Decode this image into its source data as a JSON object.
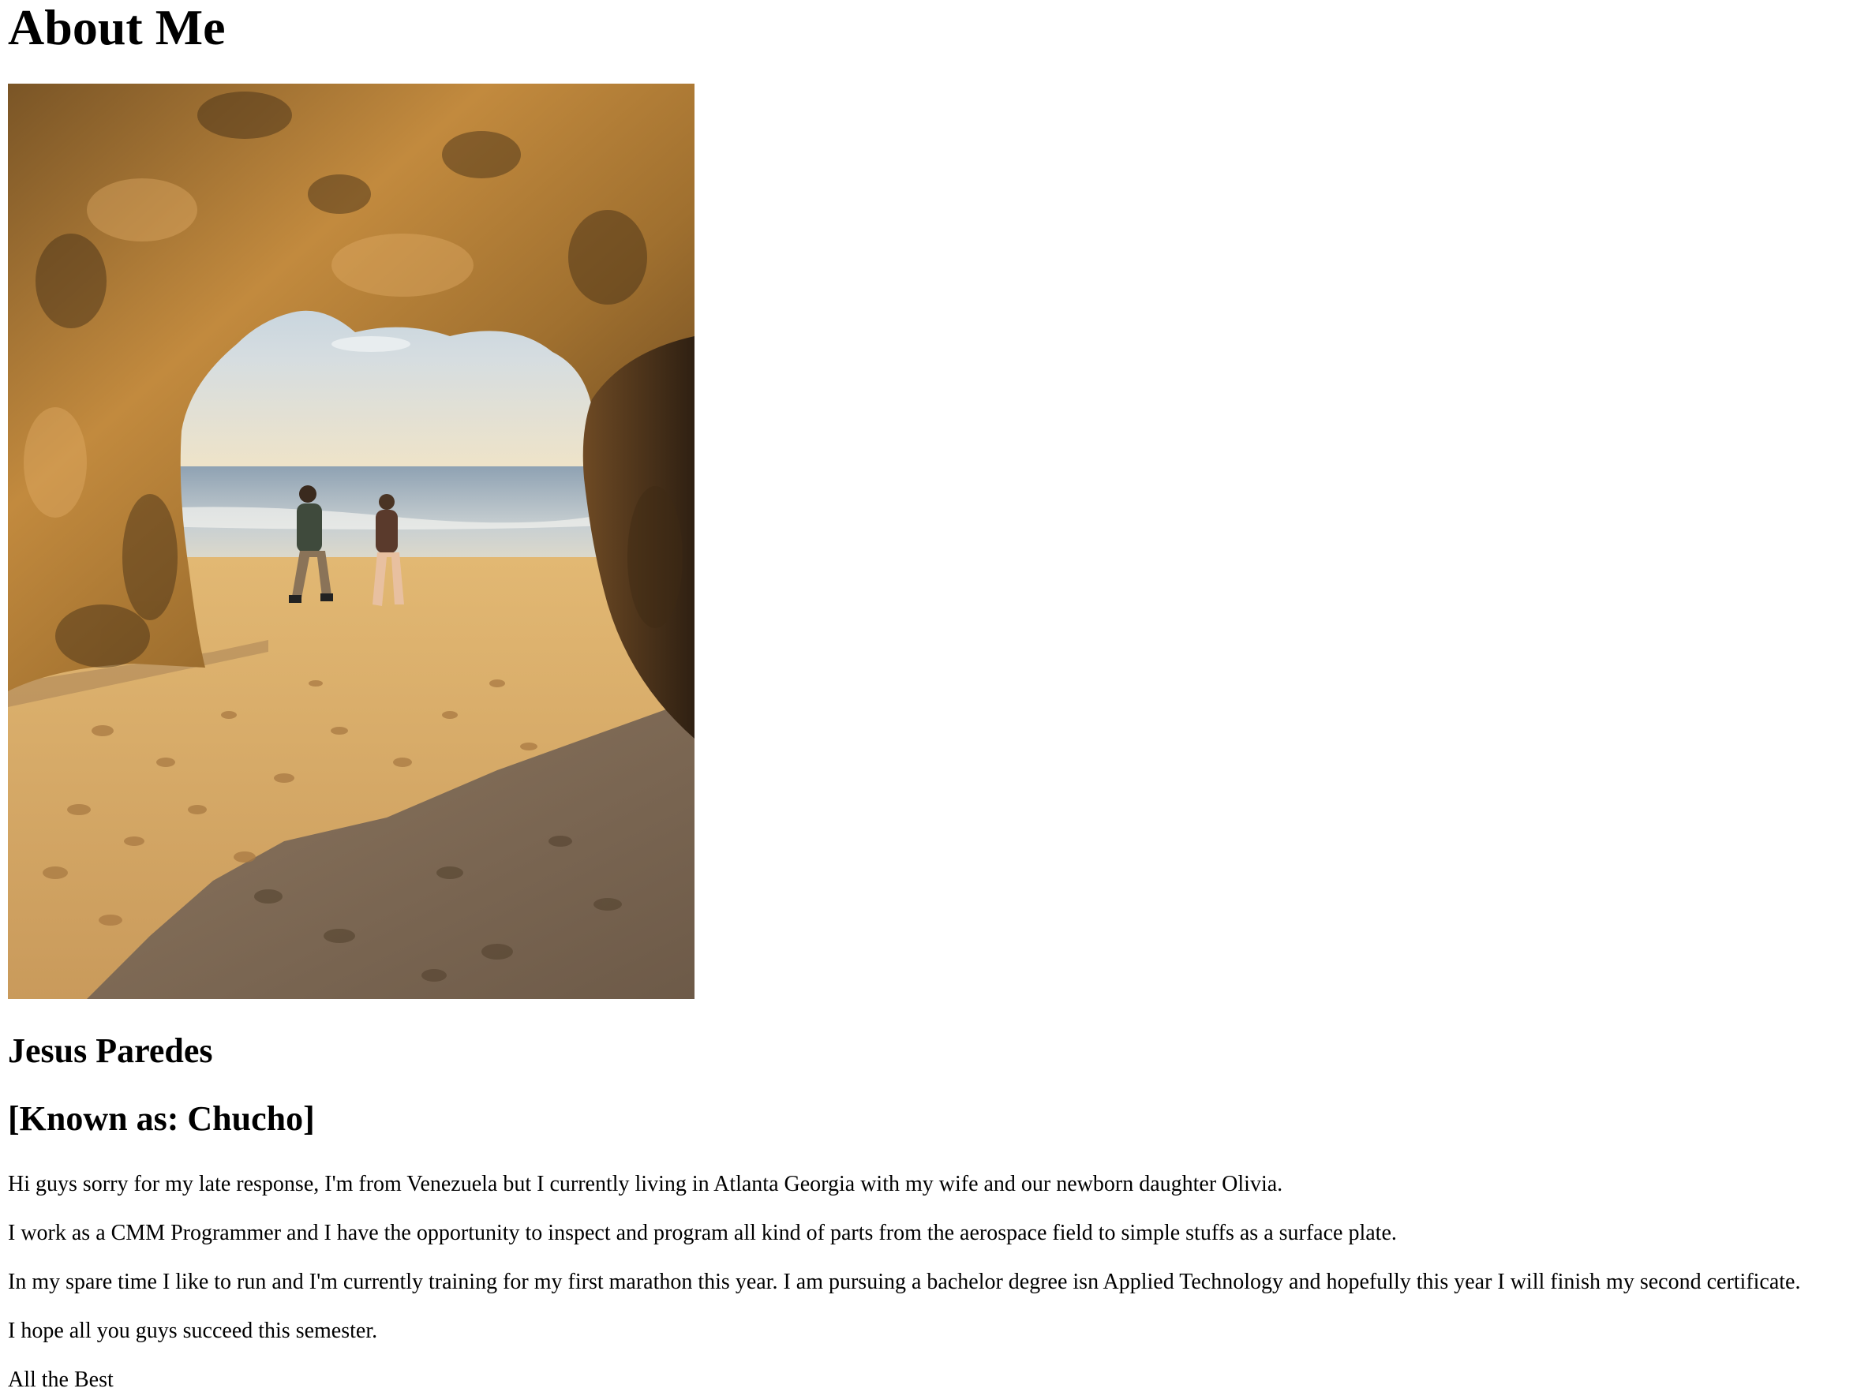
{
  "page": {
    "title": "About Me",
    "photo_alt": "Beach cave photo",
    "name": "Jesus Paredes",
    "nickname": "[Known as: Chucho]",
    "paragraphs": [
      "Hi guys sorry for my late response, I'm from Venezuela but I currently living in Atlanta Georgia with my wife and our newborn daughter Olivia.",
      "I work as a CMM Programmer and I have the opportunity to inspect and program all kind of parts from the aerospace field to simple stuffs as a surface plate.",
      "In my spare time I like to run and I'm currently training for my first marathon this year. I am pursuing a bachelor degree isn Applied Technology and hopefully this year I will finish my second certificate.",
      "I hope all you guys succeed this semester.",
      "All the Best"
    ]
  }
}
